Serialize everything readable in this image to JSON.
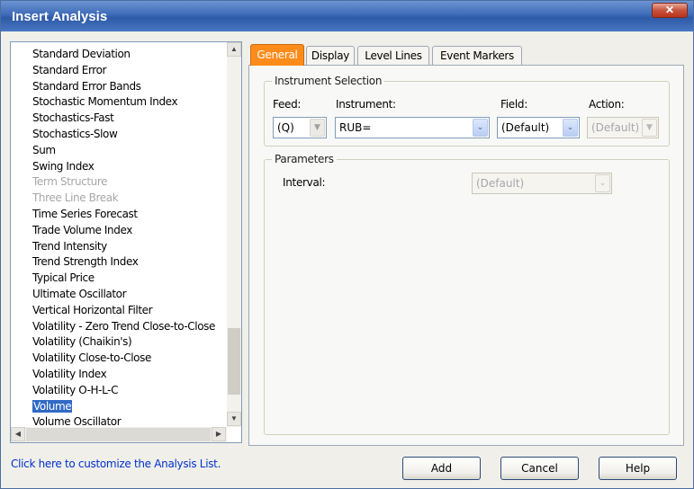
{
  "window": {
    "title": "Insert Analysis",
    "close_symbol": "✕"
  },
  "analysis_list": {
    "items": [
      {
        "label": "Standard Deviation",
        "state": "normal"
      },
      {
        "label": "Standard Error",
        "state": "normal"
      },
      {
        "label": "Standard Error Bands",
        "state": "normal"
      },
      {
        "label": "Stochastic Momentum Index",
        "state": "normal"
      },
      {
        "label": "Stochastics-Fast",
        "state": "normal"
      },
      {
        "label": "Stochastics-Slow",
        "state": "normal"
      },
      {
        "label": "Sum",
        "state": "normal"
      },
      {
        "label": "Swing Index",
        "state": "normal"
      },
      {
        "label": "Term Structure",
        "state": "disabled"
      },
      {
        "label": "Three Line Break",
        "state": "disabled"
      },
      {
        "label": "Time Series Forecast",
        "state": "normal"
      },
      {
        "label": "Trade Volume Index",
        "state": "normal"
      },
      {
        "label": "Trend Intensity",
        "state": "normal"
      },
      {
        "label": "Trend Strength Index",
        "state": "normal"
      },
      {
        "label": "Typical Price",
        "state": "normal"
      },
      {
        "label": "Ultimate Oscillator",
        "state": "normal"
      },
      {
        "label": "Vertical Horizontal Filter",
        "state": "normal"
      },
      {
        "label": "Volatility - Zero Trend Close-to-Close",
        "state": "normal"
      },
      {
        "label": "Volatility (Chaikin's)",
        "state": "normal"
      },
      {
        "label": "Volatility Close-to-Close",
        "state": "normal"
      },
      {
        "label": "Volatility Index",
        "state": "normal"
      },
      {
        "label": "Volatility O-H-L-C",
        "state": "normal"
      },
      {
        "label": "Volume",
        "state": "selected"
      },
      {
        "label": "Volume Oscillator",
        "state": "normal"
      }
    ],
    "scroll_up": "▲",
    "scroll_down": "▼",
    "scroll_left": "◀",
    "scroll_right": "▶"
  },
  "customize_link": "Click here to customize the Analysis List.",
  "tabs": [
    {
      "label": "General",
      "active": true
    },
    {
      "label": "Display",
      "active": false
    },
    {
      "label": "Level Lines",
      "active": false
    },
    {
      "label": "Event Markers",
      "active": false
    }
  ],
  "instrument_selection": {
    "title": "Instrument Selection",
    "feed": {
      "label": "Feed:",
      "value": "(Q)"
    },
    "instrument": {
      "label": "Instrument:",
      "value": "RUB="
    },
    "field": {
      "label": "Field:",
      "value": "(Default)"
    },
    "action": {
      "label": "Action:",
      "value": "(Default)"
    },
    "dropdown_arrow": "▼",
    "chevron": "⌄"
  },
  "parameters": {
    "title": "Parameters",
    "interval": {
      "label": "Interval:",
      "value": "(Default)"
    }
  },
  "buttons": {
    "add": "Add",
    "cancel": "Cancel",
    "help": "Help"
  },
  "colors": {
    "accent_tab": "#ff8c1a",
    "selection": "#316ac5",
    "title_bar": "#3d6bb8",
    "link": "#0033cc"
  }
}
